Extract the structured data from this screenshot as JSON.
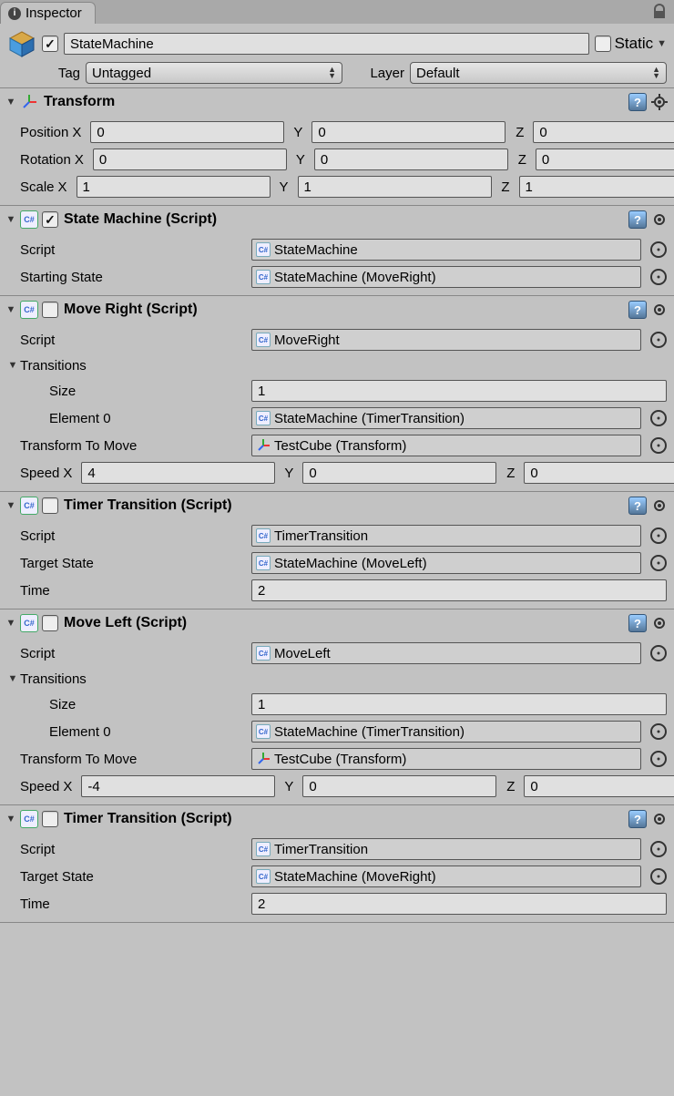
{
  "tabTitle": "Inspector",
  "header": {
    "name": "StateMachine",
    "staticLabel": "Static",
    "tagLabel": "Tag",
    "tagValue": "Untagged",
    "layerLabel": "Layer",
    "layerValue": "Default"
  },
  "transform": {
    "title": "Transform",
    "posLabel": "Position",
    "rotLabel": "Rotation",
    "scaleLabel": "Scale",
    "pos": {
      "x": "0",
      "y": "0",
      "z": "0"
    },
    "rot": {
      "x": "0",
      "y": "0",
      "z": "0"
    },
    "scale": {
      "x": "1",
      "y": "1",
      "z": "1"
    },
    "xL": "X",
    "yL": "Y",
    "zL": "Z"
  },
  "stateMachine": {
    "title": "State Machine (Script)",
    "scriptLabel": "Script",
    "scriptValue": "StateMachine",
    "startingLabel": "Starting State",
    "startingValue": "StateMachine (MoveRight)"
  },
  "moveRight": {
    "title": "Move Right (Script)",
    "scriptLabel": "Script",
    "scriptValue": "MoveRight",
    "transLabel": "Transitions",
    "sizeLabel": "Size",
    "sizeValue": "1",
    "el0Label": "Element 0",
    "el0Value": "StateMachine (TimerTransition)",
    "tfmLabel": "Transform To Move",
    "tfmValue": "TestCube (Transform)",
    "speedLabel": "Speed",
    "speed": {
      "x": "4",
      "y": "0",
      "z": "0"
    },
    "xL": "X",
    "yL": "Y",
    "zL": "Z"
  },
  "timer1": {
    "title": "Timer Transition (Script)",
    "scriptLabel": "Script",
    "scriptValue": "TimerTransition",
    "targetLabel": "Target State",
    "targetValue": "StateMachine (MoveLeft)",
    "timeLabel": "Time",
    "timeValue": "2"
  },
  "moveLeft": {
    "title": "Move Left (Script)",
    "scriptLabel": "Script",
    "scriptValue": "MoveLeft",
    "transLabel": "Transitions",
    "sizeLabel": "Size",
    "sizeValue": "1",
    "el0Label": "Element 0",
    "el0Value": "StateMachine (TimerTransition)",
    "tfmLabel": "Transform To Move",
    "tfmValue": "TestCube (Transform)",
    "speedLabel": "Speed",
    "speed": {
      "x": "-4",
      "y": "0",
      "z": "0"
    },
    "xL": "X",
    "yL": "Y",
    "zL": "Z"
  },
  "timer2": {
    "title": "Timer Transition (Script)",
    "scriptLabel": "Script",
    "scriptValue": "TimerTransition",
    "targetLabel": "Target State",
    "targetValue": "StateMachine (MoveRight)",
    "timeLabel": "Time",
    "timeValue": "2"
  }
}
